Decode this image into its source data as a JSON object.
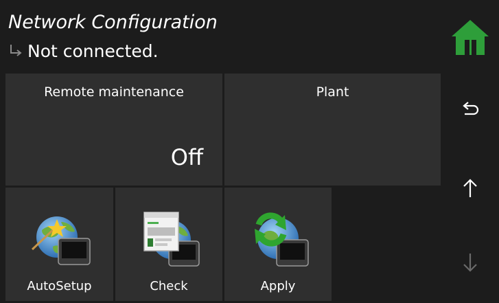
{
  "header": {
    "title": "Network Configuration",
    "status": "Not connected."
  },
  "tiles": {
    "remote_maintenance": {
      "label": "Remote maintenance",
      "value": "Off"
    },
    "plant": {
      "label": "Plant",
      "value": ""
    }
  },
  "actions": [
    {
      "label": "AutoSetup",
      "icon": "globe-terminal-star-icon"
    },
    {
      "label": "Check",
      "icon": "globe-terminal-screenshot-icon"
    },
    {
      "label": "Apply",
      "icon": "globe-terminal-refresh-icon"
    }
  ],
  "rail": {
    "home_icon": "home-icon",
    "back_icon": "back-icon",
    "up_icon": "arrow-up-icon",
    "down_icon": "arrow-down-icon"
  },
  "colors": {
    "background": "#1c1c1c",
    "tile": "#2f2f2f",
    "home_green": "#2e9e3a",
    "disabled_arrow": "#6a6a6a"
  }
}
